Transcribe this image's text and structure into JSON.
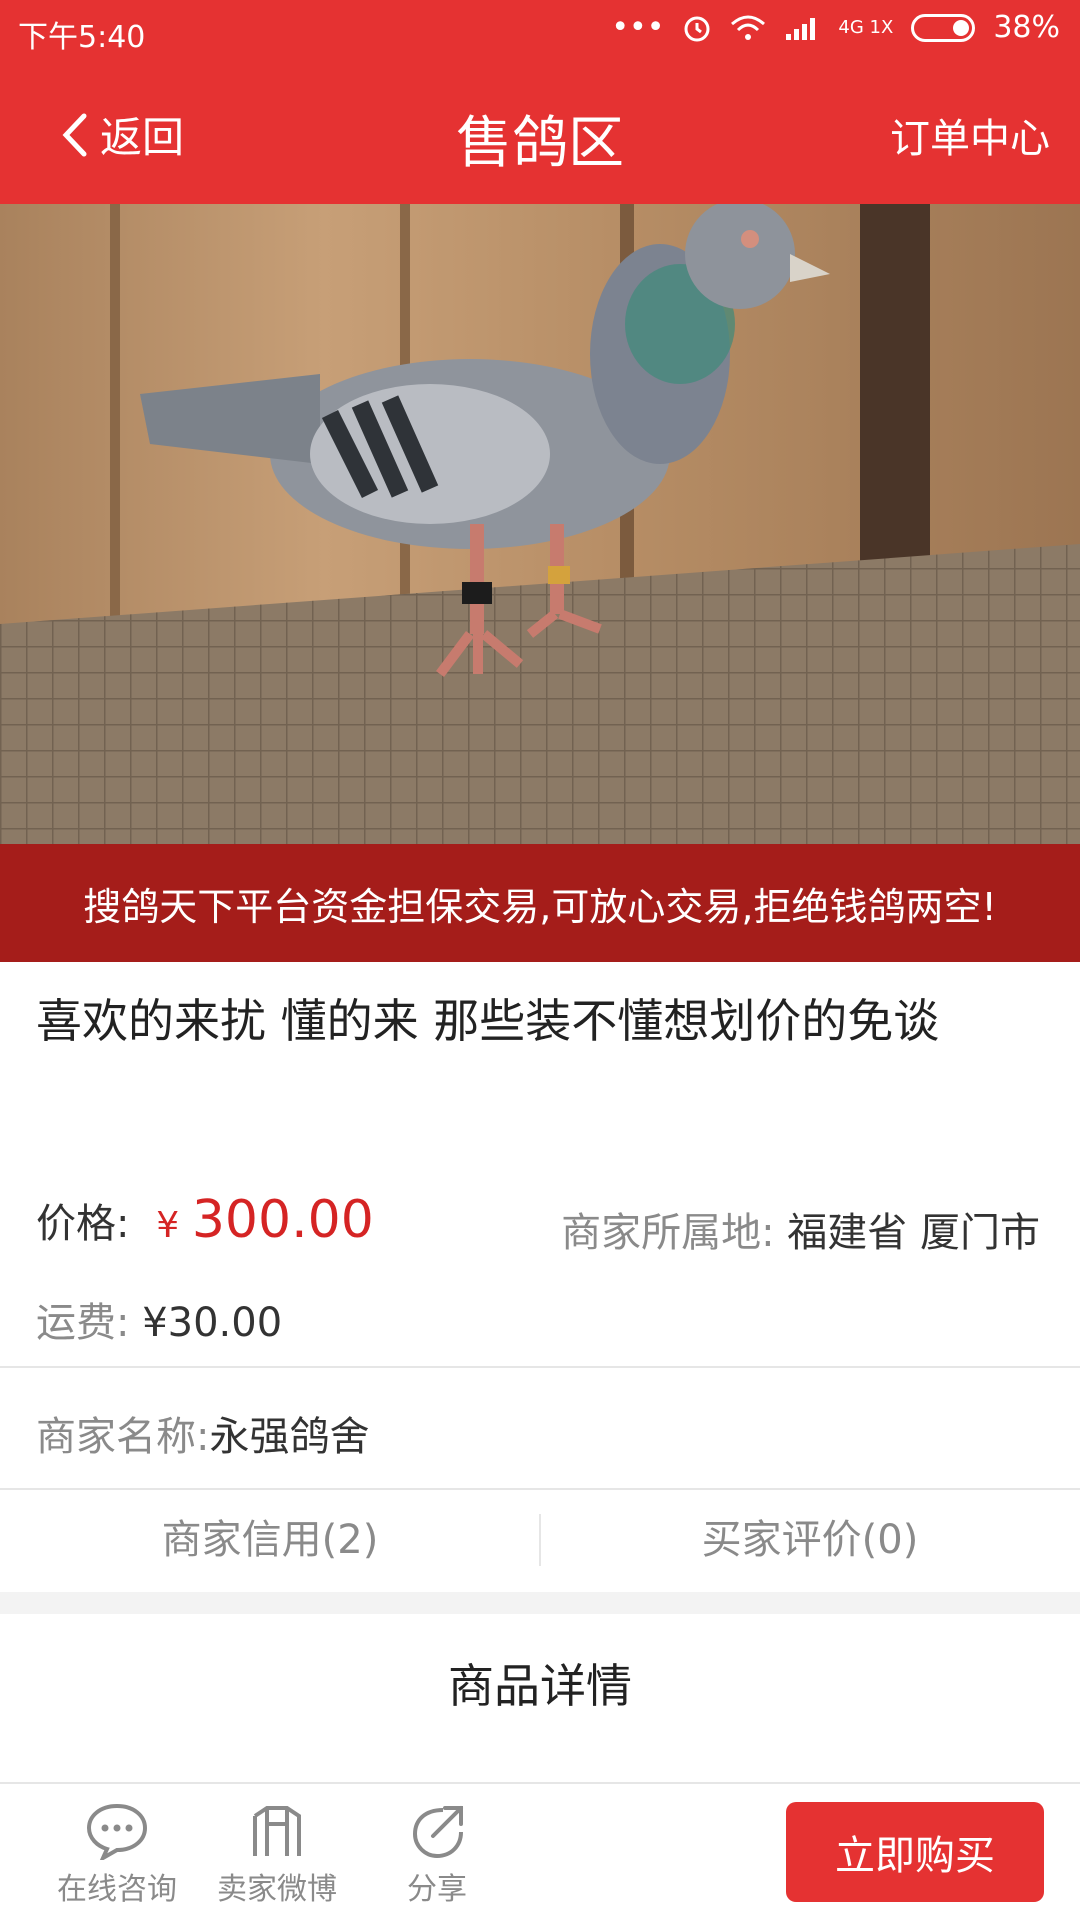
{
  "status_bar": {
    "time": "下午5:40",
    "network": "4G 1X",
    "battery": "38%"
  },
  "nav": {
    "back_label": "返回",
    "title": "售鸽区",
    "right_label": "订单中心"
  },
  "hero": {
    "image": "pigeon-photo"
  },
  "banner_text": "搜鸽天下平台资金担保交易,可放心交易,拒绝钱鸽两空!",
  "product": {
    "title": "喜欢的来扰  懂的来   那些装不懂想划价的免谈",
    "price_label": "价格:",
    "price_currency": "¥",
    "price_value": "300.00",
    "location_label": "商家所属地:",
    "location_value": "福建省 厦门市",
    "shipping_label": "运费:",
    "shipping_value": "¥30.00",
    "merchant_label": "商家名称:",
    "merchant_value": "永强鸽舍"
  },
  "tabs": {
    "seller_credit": "商家信用(2)",
    "buyer_reviews": "买家评价(0)"
  },
  "details_title": "商品详情",
  "bottom_bar": {
    "consult": "在线咨询",
    "weibo": "卖家微博",
    "share": "分享",
    "buy": "立即购买"
  },
  "colors": {
    "primary": "#e53232",
    "banner": "#a51d1a",
    "price": "#d52424"
  }
}
